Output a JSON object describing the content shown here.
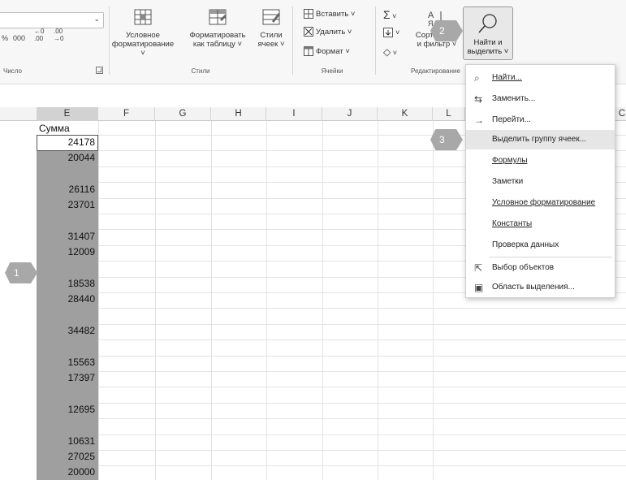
{
  "ribbon": {
    "number_group": {
      "label": "Число",
      "thousands_sep": "000",
      "increase_decimal": ".00",
      "decrease_decimal": ".00"
    },
    "styles_group": {
      "label": "Стили",
      "conditional_formatting": {
        "line1": "Условное",
        "line2": "форматирование ˅"
      },
      "format_as_table": {
        "line1": "Форматировать",
        "line2": "как таблицу ˅"
      },
      "cell_styles": {
        "line1": "Стили",
        "line2": "ячеек ˅"
      }
    },
    "cells_group": {
      "label": "Ячейки",
      "insert": "Вставить ˅",
      "delete": "Удалить ˅",
      "format": "Формат ˅"
    },
    "editing_group": {
      "label": "Редактирование",
      "sort_filter": {
        "line1": "Сортировка",
        "line2": "и фильтр ˅"
      },
      "find_select": {
        "line1": "Найти и",
        "line2": "выделить ˅"
      }
    }
  },
  "grid": {
    "columns": [
      "E",
      "F",
      "G",
      "H",
      "I",
      "J",
      "K",
      "L",
      "C"
    ],
    "header_cell": "Сумма",
    "values": [
      "24178",
      "20044",
      "26116",
      "23701",
      "31407",
      "12009",
      "18538",
      "28440",
      "34482",
      "15563",
      "17397",
      "12695",
      "10631",
      "27025",
      "20000"
    ]
  },
  "find_menu": {
    "items": [
      {
        "label": "Найти...",
        "icon": "search-icon"
      },
      {
        "label": "Заменить...",
        "icon": "replace-icon"
      },
      {
        "label": "Перейти...",
        "icon": "arrow-right-icon"
      },
      {
        "label": "Выделить группу ячеек...",
        "icon": ""
      },
      {
        "label": "Формулы",
        "icon": ""
      },
      {
        "label": "Заметки",
        "icon": ""
      },
      {
        "label": "Условное форматирование",
        "icon": ""
      },
      {
        "label": "Константы",
        "icon": ""
      },
      {
        "label": "Проверка данных",
        "icon": ""
      },
      {
        "label": "Выбор объектов",
        "icon": "pointer-icon"
      },
      {
        "label": "Область выделения...",
        "icon": "selection-pane-icon"
      }
    ]
  },
  "badges": {
    "step1": "1",
    "step2": "2",
    "step3": "3"
  },
  "colors": {
    "selection": "#9f9f9f",
    "badge": "#a8a8a8",
    "menu_hover": "#e6e6e6"
  }
}
